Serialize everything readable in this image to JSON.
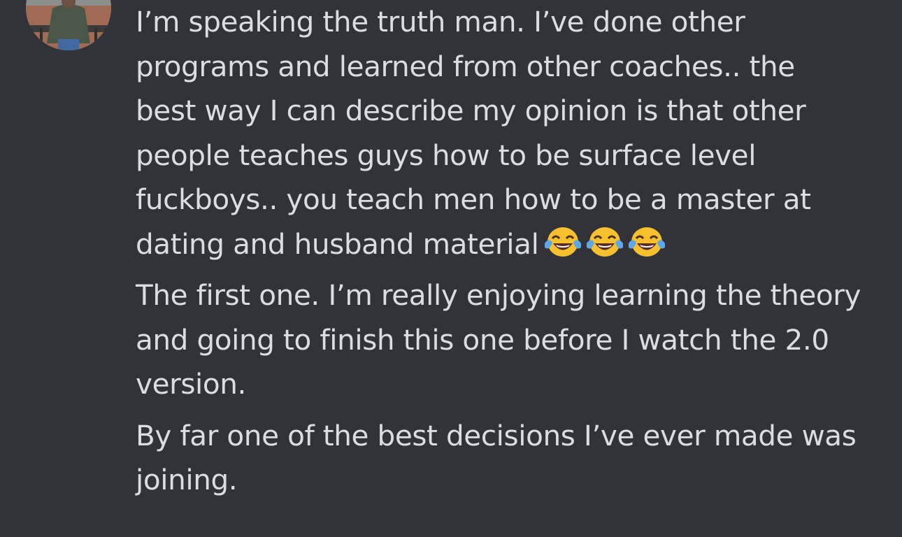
{
  "messages": [
    {
      "lines": [
        "I’m speaking the truth man. I’ve done other",
        "programs and learned from other coaches.. the",
        "best way I can describe my opinion is that other",
        "people teaches guys how to be surface level",
        "fuckboys.. you teach men how to be a master at",
        "dating and husband material"
      ],
      "emojis": [
        "face-with-tears-of-joy-icon",
        "face-with-tears-of-joy-icon",
        "face-with-tears-of-joy-icon"
      ]
    },
    {
      "lines": [
        "The first one. I’m really enjoying learning the theory",
        "and going to finish this one before I watch the 2.0",
        "version."
      ]
    },
    {
      "lines": [
        "By far one of the best decisions I’ve ever made was",
        "joining."
      ]
    }
  ],
  "colors": {
    "background": "#313338",
    "text": "#dbdee1",
    "emoji_face": "#f7c02e",
    "emoji_tears": "#5fa8e8"
  }
}
